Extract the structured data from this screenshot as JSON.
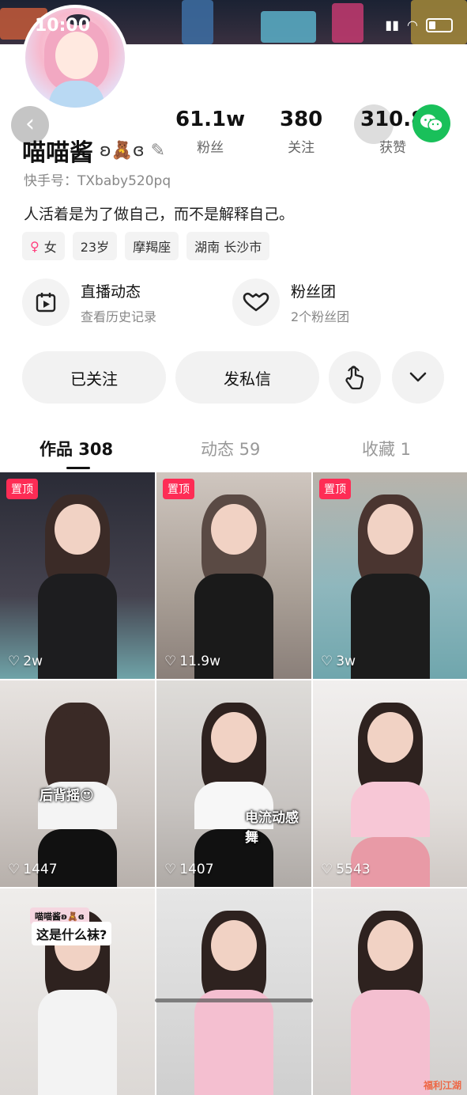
{
  "status_bar": {
    "time": "10:00"
  },
  "profile": {
    "name": "喵喵酱",
    "name_decoration": "ʚ🧸ɞ",
    "kuaishou_id": "快手号：TXbaby520pq",
    "bio": "人活着是为了做自己，而不是解释自己。",
    "tags": [
      "女",
      "23岁",
      "摩羯座",
      "湖南 长沙市"
    ]
  },
  "stats": [
    {
      "value": "61.1w",
      "label": "粉丝"
    },
    {
      "value": "380",
      "label": "关注"
    },
    {
      "value": "310.8",
      "label": "获赞"
    }
  ],
  "features": [
    {
      "title": "直播动态",
      "subtitle": "查看历史记录",
      "icon": "calendar-play-icon"
    },
    {
      "title": "粉丝团",
      "subtitle": "2个粉丝团",
      "icon": "heart-shield-icon"
    }
  ],
  "actions": {
    "follow_label": "已关注",
    "message_label": "发私信"
  },
  "tabs": [
    {
      "label": "作品 308",
      "active": true
    },
    {
      "label": "动态 59",
      "active": false
    },
    {
      "label": "收藏 1",
      "active": false
    }
  ],
  "posts": [
    {
      "pinned": true,
      "pin_label": "置顶",
      "likes": "2w",
      "overlay": ""
    },
    {
      "pinned": true,
      "pin_label": "置顶",
      "likes": "11.9w",
      "overlay": ""
    },
    {
      "pinned": true,
      "pin_label": "置顶",
      "likes": "3w",
      "overlay": ""
    },
    {
      "pinned": false,
      "likes": "1447",
      "overlay": "后背摇😍"
    },
    {
      "pinned": false,
      "likes": "1407",
      "overlay": "电流动感舞"
    },
    {
      "pinned": false,
      "likes": "5543",
      "overlay": ""
    },
    {
      "pinned": false,
      "likes": "",
      "overlay": "这是什么袜?",
      "overlay_small": "喵喵酱ʚ🧸ɞ"
    },
    {
      "pinned": false,
      "likes": "",
      "overlay": ""
    },
    {
      "pinned": false,
      "likes": "",
      "overlay": ""
    }
  ],
  "watermark": "福利江湖",
  "colors": {
    "accent": "#fe2c55",
    "wechat": "#19c05a",
    "female": "#ff3e7d"
  }
}
